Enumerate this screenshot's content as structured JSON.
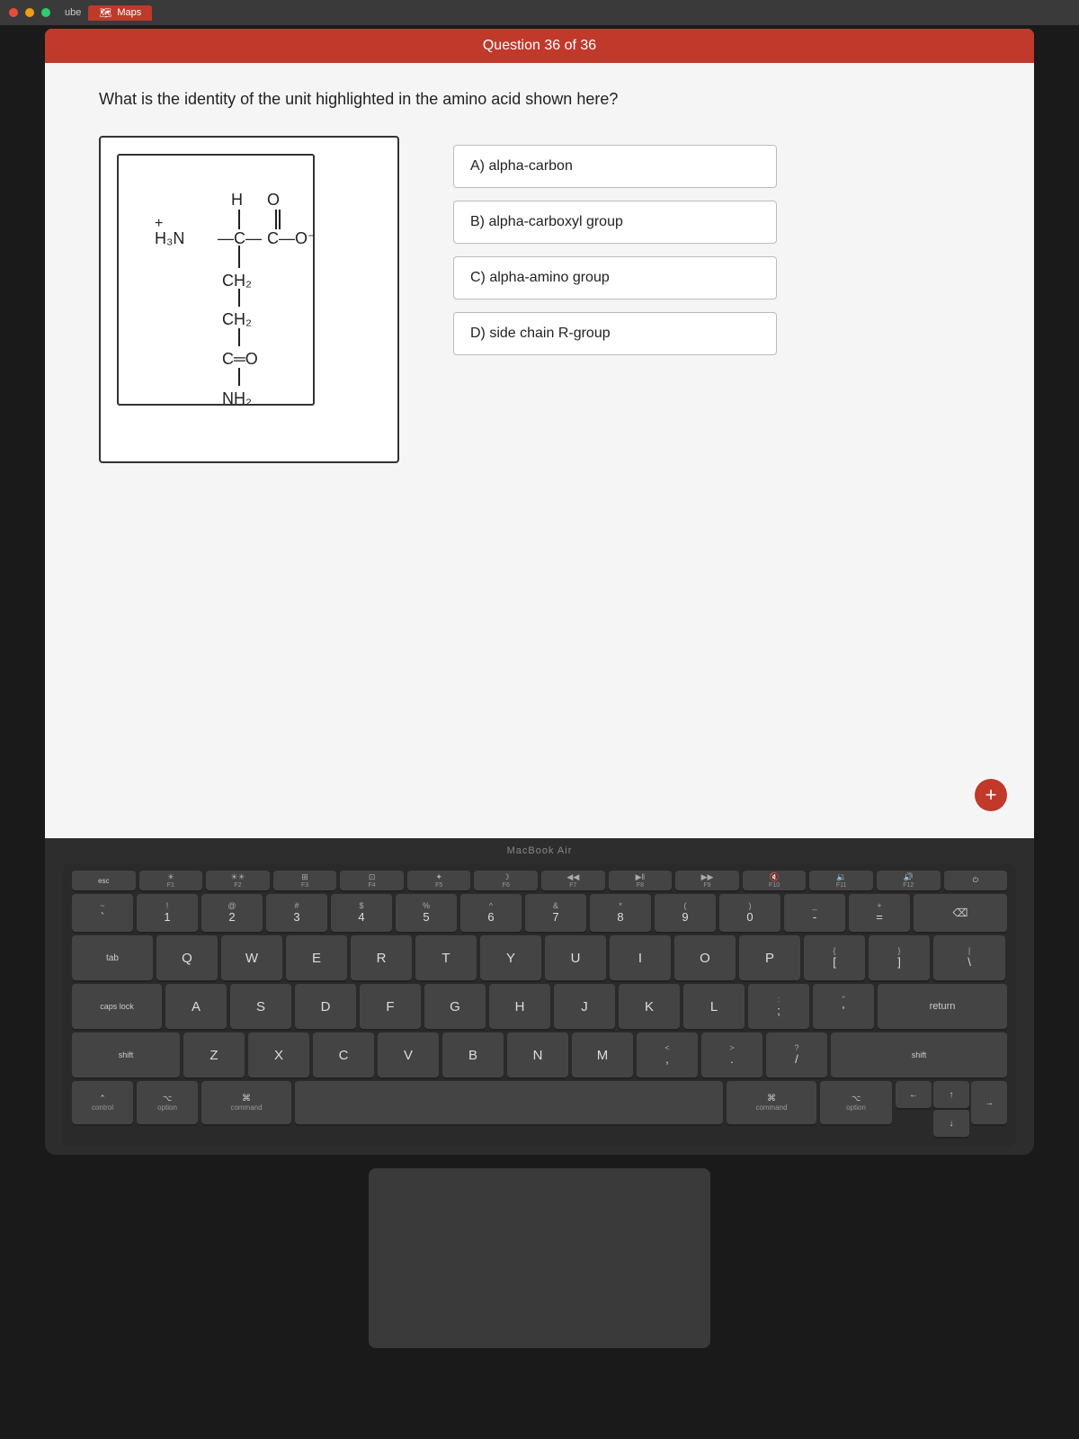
{
  "browser": {
    "tab_text": "Maps",
    "tab_label2": "ube"
  },
  "quiz": {
    "header": "Question 36 of 36",
    "question": "What is the identity of the unit highlighted in the amino acid shown here?",
    "answers": [
      {
        "id": "A",
        "text": "A) alpha-carbon"
      },
      {
        "id": "B",
        "text": "B) alpha-carboxyl group"
      },
      {
        "id": "C",
        "text": "C) alpha-amino group"
      },
      {
        "id": "D",
        "text": "D) side chain R-group"
      }
    ],
    "plus_button": "+"
  },
  "macbook_label": "MacBook Air",
  "keyboard": {
    "fn_keys": [
      "F1",
      "F2",
      "F3",
      "F4",
      "F5",
      "F6",
      "F7",
      "F8",
      "F9",
      "F10",
      "F11",
      "F12"
    ],
    "bottom_labels": {
      "control": "control",
      "option_l": "option",
      "command_l": "command",
      "command_r": "command",
      "option_r": "option",
      "tion": "tion"
    }
  }
}
